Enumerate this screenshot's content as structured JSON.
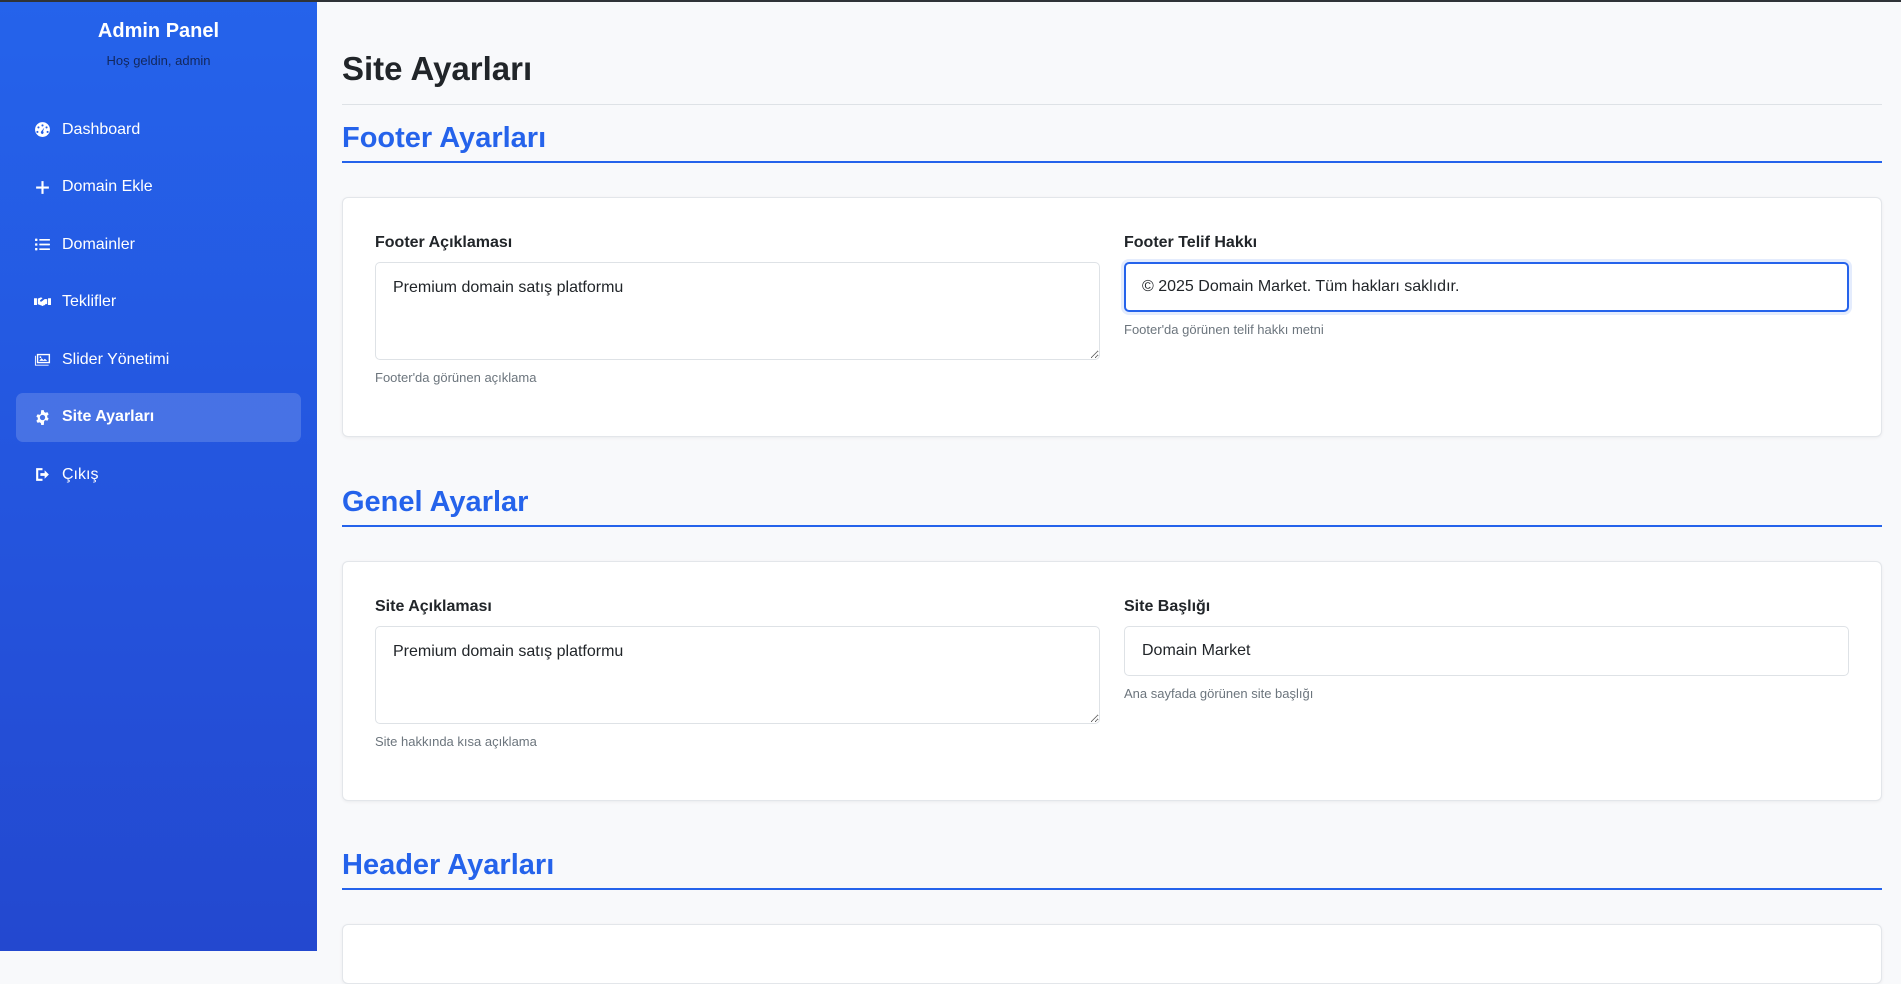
{
  "sidebar": {
    "brand_title": "Admin Panel",
    "brand_subtitle": "Hoş geldin, admin",
    "items": [
      {
        "label": "Dashboard",
        "icon": "dashboard-icon"
      },
      {
        "label": "Domain Ekle",
        "icon": "plus-icon"
      },
      {
        "label": "Domainler",
        "icon": "list-icon"
      },
      {
        "label": "Teklifler",
        "icon": "handshake-icon"
      },
      {
        "label": "Slider Yönetimi",
        "icon": "images-icon"
      },
      {
        "label": "Site Ayarları",
        "icon": "gear-icon",
        "active": true
      },
      {
        "label": "Çıkış",
        "icon": "sign-out-icon"
      }
    ]
  },
  "main": {
    "page_title": "Site Ayarları",
    "sections": {
      "footer": {
        "title": "Footer Ayarları",
        "description_label": "Footer Açıklaması",
        "description_value": "Premium domain satış platformu",
        "description_help": "Footer'da görünen açıklama",
        "copyright_label": "Footer Telif Hakkı",
        "copyright_value": "© 2025 Domain Market. Tüm hakları saklıdır.",
        "copyright_help": "Footer'da görünen telif hakkı metni"
      },
      "general": {
        "title": "Genel Ayarlar",
        "description_label": "Site Açıklaması",
        "description_value": "Premium domain satış platformu",
        "description_help": "Site hakkında kısa açıklama",
        "site_title_label": "Site Başlığı",
        "site_title_value": "Domain Market",
        "site_title_help": "Ana sayfada görünen site başlığı"
      },
      "header": {
        "title": "Header Ayarları"
      }
    }
  },
  "colors": {
    "accent": "#2563eb",
    "sidebar_top": "#2563eb",
    "sidebar_bottom": "#2348cf",
    "background": "#f8f9fb"
  }
}
